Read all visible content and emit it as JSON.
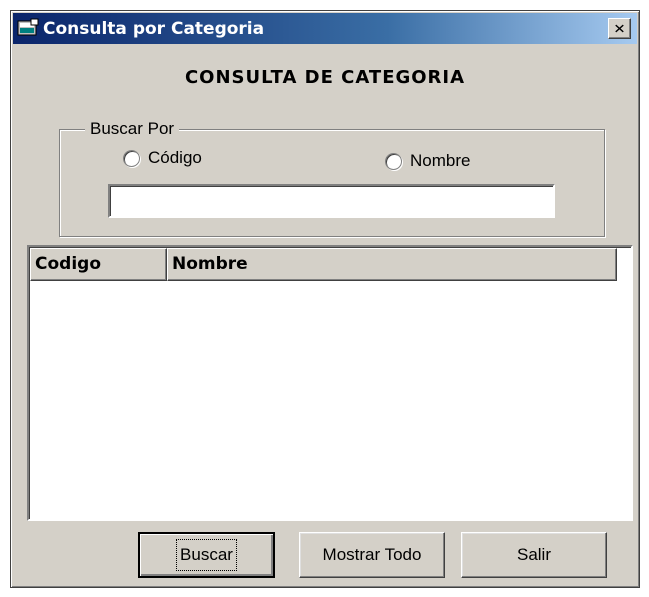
{
  "window": {
    "title": "Consulta por Categoria",
    "close_label": "×"
  },
  "form": {
    "heading": "CONSULTA DE CATEGORIA",
    "search_group": {
      "legend": "Buscar Por",
      "options": [
        {
          "label": "Código",
          "selected": false
        },
        {
          "label": "Nombre",
          "selected": false
        }
      ],
      "input_value": "",
      "input_placeholder": ""
    },
    "list": {
      "columns": [
        "Codigo",
        "Nombre"
      ],
      "rows": []
    },
    "buttons": {
      "search": "Buscar",
      "show_all": "Mostrar Todo",
      "exit": "Salir"
    }
  },
  "colors": {
    "face": "#d4d0c8",
    "title_start": "#0a246a",
    "title_end": "#a6caf0"
  },
  "icons": {
    "app": "window-app-icon",
    "close": "close-icon"
  }
}
